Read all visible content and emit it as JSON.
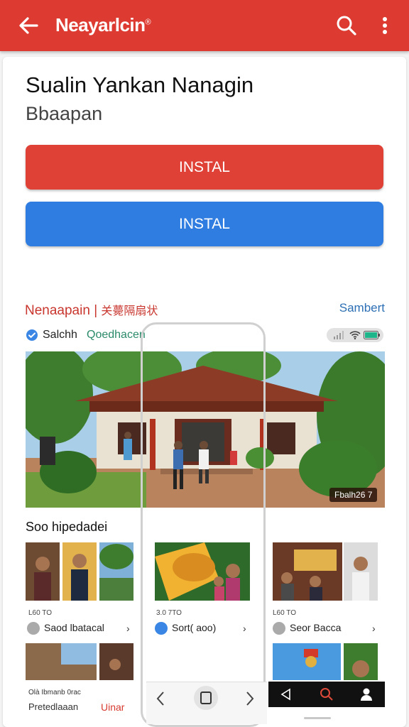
{
  "appbar": {
    "title": "Neayarlcin",
    "title_mark": "®",
    "back_icon": "arrow-left-icon",
    "search_icon": "search-icon",
    "more_icon": "more-vert-icon",
    "color": "#dd3b32"
  },
  "app": {
    "name": "Sualin Yankan Nanagin",
    "subtitle": "Bbaapan"
  },
  "buttons": {
    "install_red": "INSTAL",
    "install_blue": "INSTAL",
    "red": "#e04137",
    "blue": "#2f7de1"
  },
  "section": {
    "title": "Nenaapain",
    "title_cjk": "关薨隔扇状",
    "link": "Sambert",
    "badge_label": "Salchh",
    "badge_sub": "Qoedhacen"
  },
  "hero": {
    "badge": "Fbalh26 7"
  },
  "grid": {
    "title": "Soo hipedadei",
    "items": [
      {
        "caption": "L60 TO",
        "label": "Saod lbatacal"
      },
      {
        "caption": "3.0 7TO",
        "label": "Sort( aoo)"
      },
      {
        "caption": "L60 TO",
        "label": "Seor Bacca"
      }
    ],
    "bottom_small": "Olà Ibmanb 0rac",
    "bottom_main": "Pretedlaaan",
    "bottom_link": "Uinar"
  },
  "navbar": {
    "back_icon": "chevron-left-icon",
    "home_icon": "square-icon",
    "forward_icon": "chevron-right-icon",
    "triangle_icon": "triangle-back-icon",
    "search_icon": "search-icon",
    "person_icon": "person-icon"
  }
}
